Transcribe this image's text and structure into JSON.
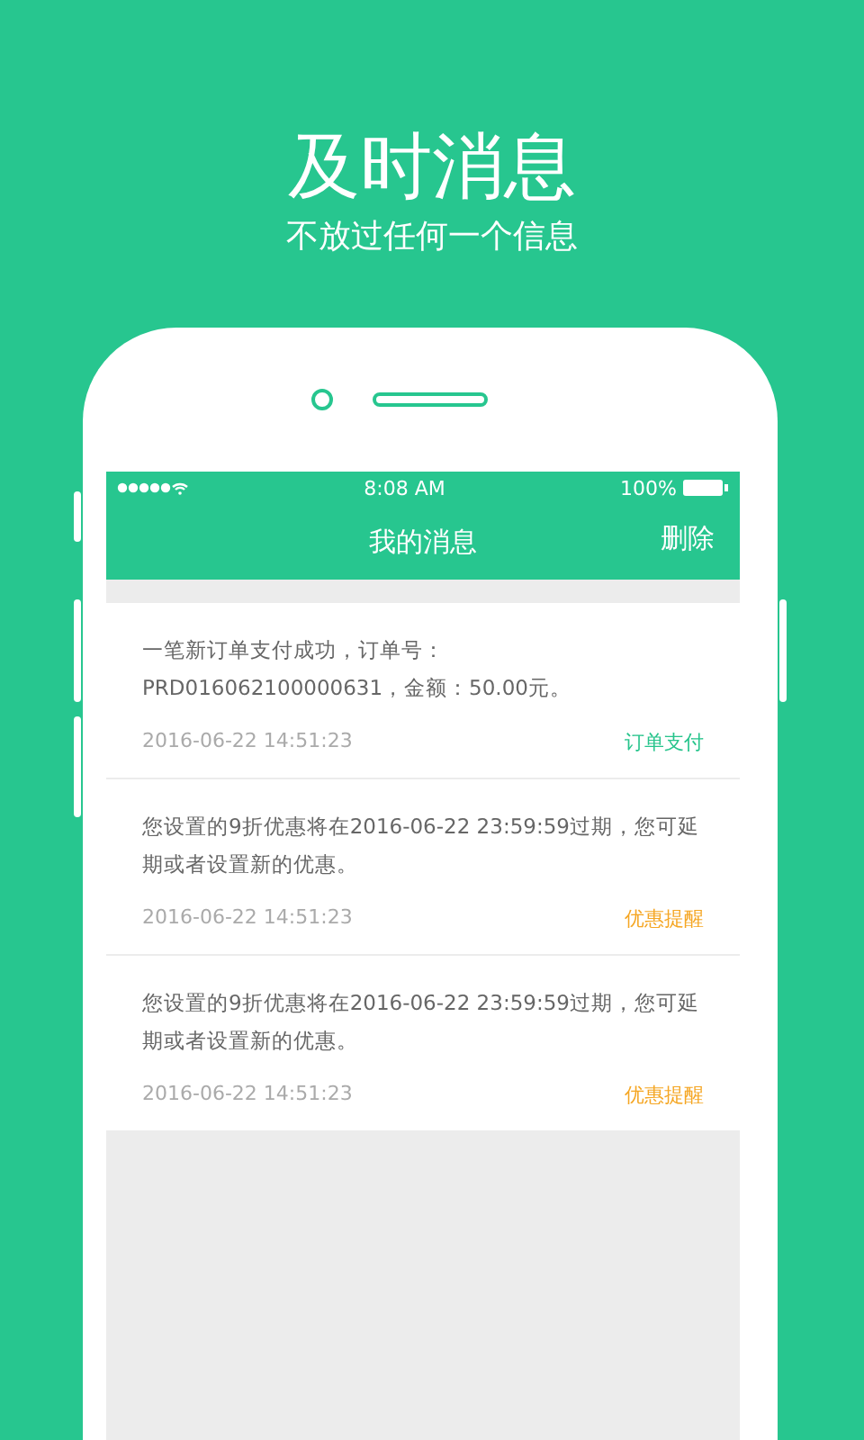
{
  "headline": {
    "title": "及时消息",
    "subtitle": "不放过任何一个信息"
  },
  "status_bar": {
    "time": "8:08 AM",
    "battery": "100%"
  },
  "nav_bar": {
    "title": "我的消息",
    "action": "删除"
  },
  "messages": [
    {
      "text": "一笔新订单支付成功，订单号：PRD016062100000631，金额：50.00元。",
      "time": "2016-06-22  14:51:23",
      "tag": "订单支付",
      "color": "#27c48c"
    },
    {
      "text": "您设置的9折优惠将在2016-06-22 23:59:59过期，您可延期或者设置新的优惠。",
      "time": "2016-06-22  14:51:23",
      "tag": "优惠提醒",
      "color": "#f5a623"
    },
    {
      "text": "您设置的9折优惠将在2016-06-22 23:59:59过期，您可延期或者设置新的优惠。",
      "time": "2016-06-22  14:51:23",
      "tag": "优惠提醒",
      "color": "#f5a623"
    }
  ]
}
